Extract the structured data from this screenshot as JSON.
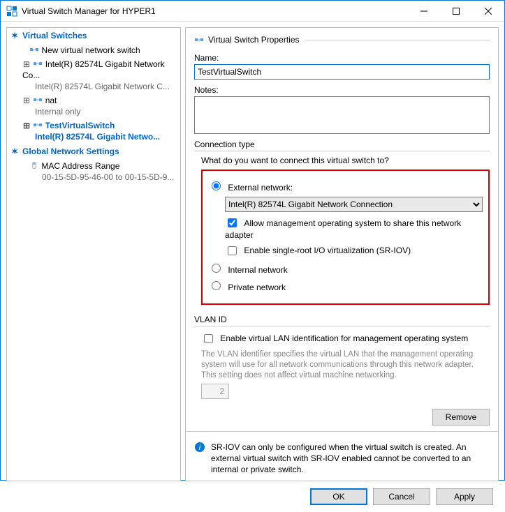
{
  "window": {
    "title": "Virtual Switch Manager for HYPER1"
  },
  "tree": {
    "group1": "Virtual Switches",
    "new_switch": "New virtual network switch",
    "sw1": {
      "name": "Intel(R) 82574L Gigabit Network Co...",
      "sub": "Intel(R) 82574L Gigabit Network C..."
    },
    "sw2": {
      "name": "nat",
      "sub": "Internal only"
    },
    "sw3": {
      "name": "TestVirtualSwitch",
      "sub": "Intel(R) 82574L Gigabit Netwo..."
    },
    "group2": "Global Network Settings",
    "mac": {
      "name": "MAC Address Range",
      "sub": "00-15-5D-95-46-00 to 00-15-5D-9..."
    }
  },
  "props": {
    "header": "Virtual Switch Properties",
    "name_label": "Name:",
    "name_value": "TestVirtualSwitch",
    "notes_label": "Notes:",
    "conn": {
      "group": "Connection type",
      "question": "What do you want to connect this virtual switch to?",
      "external": "External network:",
      "adapter": "Intel(R) 82574L Gigabit Network Connection",
      "allow_mgmt": "Allow management operating system to share this network adapter",
      "sriov": "Enable single-root I/O virtualization (SR-IOV)",
      "internal": "Internal network",
      "private": "Private network"
    },
    "vlan": {
      "group": "VLAN ID",
      "enable": "Enable virtual LAN identification for management operating system",
      "help": "The VLAN identifier specifies the virtual LAN that the management operating system will use for all network communications through this network adapter. This setting does not affect virtual machine networking.",
      "value": "2"
    },
    "remove": "Remove",
    "info": "SR-IOV can only be configured when the virtual switch is created. An external virtual switch with SR-IOV enabled cannot be converted to an internal or private switch."
  },
  "buttons": {
    "ok": "OK",
    "cancel": "Cancel",
    "apply": "Apply"
  }
}
